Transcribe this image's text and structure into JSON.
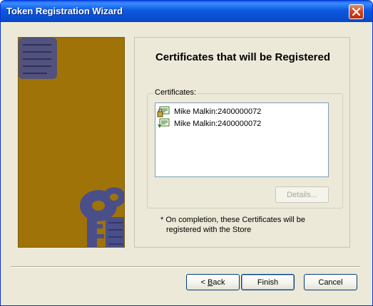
{
  "window": {
    "title": "Token Registration Wizard"
  },
  "page": {
    "heading": "Certificates that will be Registered"
  },
  "certificates": {
    "group_label": "Certificates:",
    "items": [
      {
        "label": "Mike Malkin:2400000072",
        "icon": "certificate-locked-icon"
      },
      {
        "label": "Mike Malkin:2400000072",
        "icon": "certificate-icon"
      }
    ],
    "details_label": "Details..."
  },
  "note": {
    "line1": "* On completion, these Certificates will be",
    "line2": "registered with the Store"
  },
  "buttons": {
    "back_prefix": "< ",
    "back_mnemonic": "B",
    "back_rest": "ack",
    "finish": "Finish",
    "cancel": "Cancel"
  },
  "colors": {
    "side_panel": "#a07309",
    "keys_tint": "#4a4f8a",
    "titlebar": "#0a5fe6"
  }
}
